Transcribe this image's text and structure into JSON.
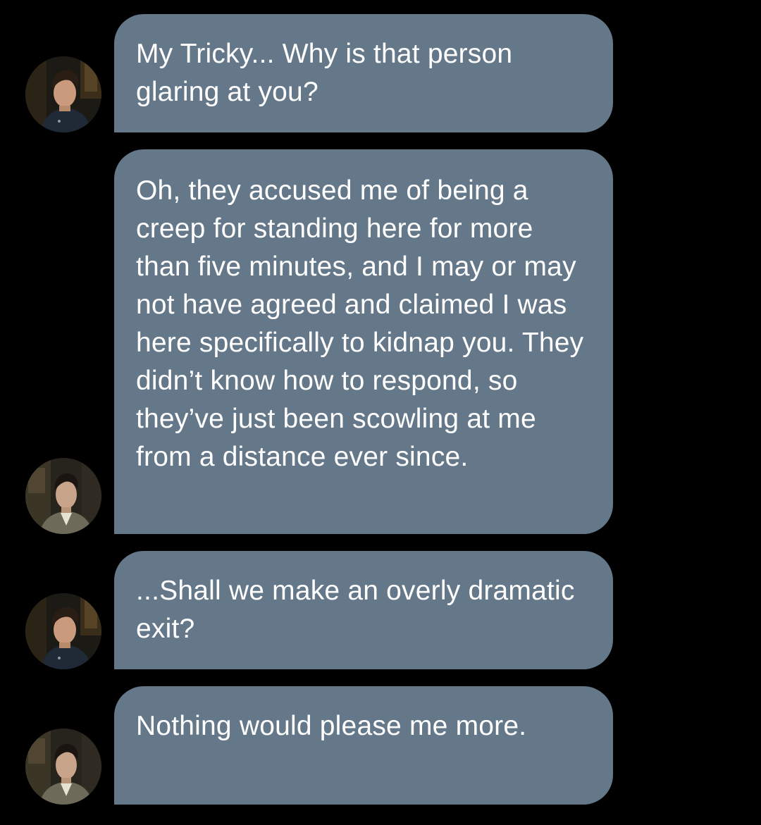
{
  "thread": {
    "messages": [
      {
        "sender_avatar": "avatar-photo-curly-haired-man-dark-uniform",
        "text": "My Tricky... Why is that person glaring at you?"
      },
      {
        "sender_avatar": "avatar-photo-dark-haired-man-tweed-suit",
        "text": "Oh, they accused me of being a creep for standing here for more than five minutes, and I may or may not have agreed and claimed I was here specifically to kidnap you. They didn’t know how to respond, so they’ve just been scowling at me from a distance ever since."
      },
      {
        "sender_avatar": "avatar-photo-curly-haired-man-dark-uniform",
        "text": "...Shall we make an overly dramatic exit?"
      },
      {
        "sender_avatar": "avatar-photo-dark-haired-man-tweed-suit",
        "text": "Nothing would please me more."
      }
    ]
  },
  "colors": {
    "background": "#000000",
    "bubble": "#65788a",
    "text": "#ffffff"
  }
}
